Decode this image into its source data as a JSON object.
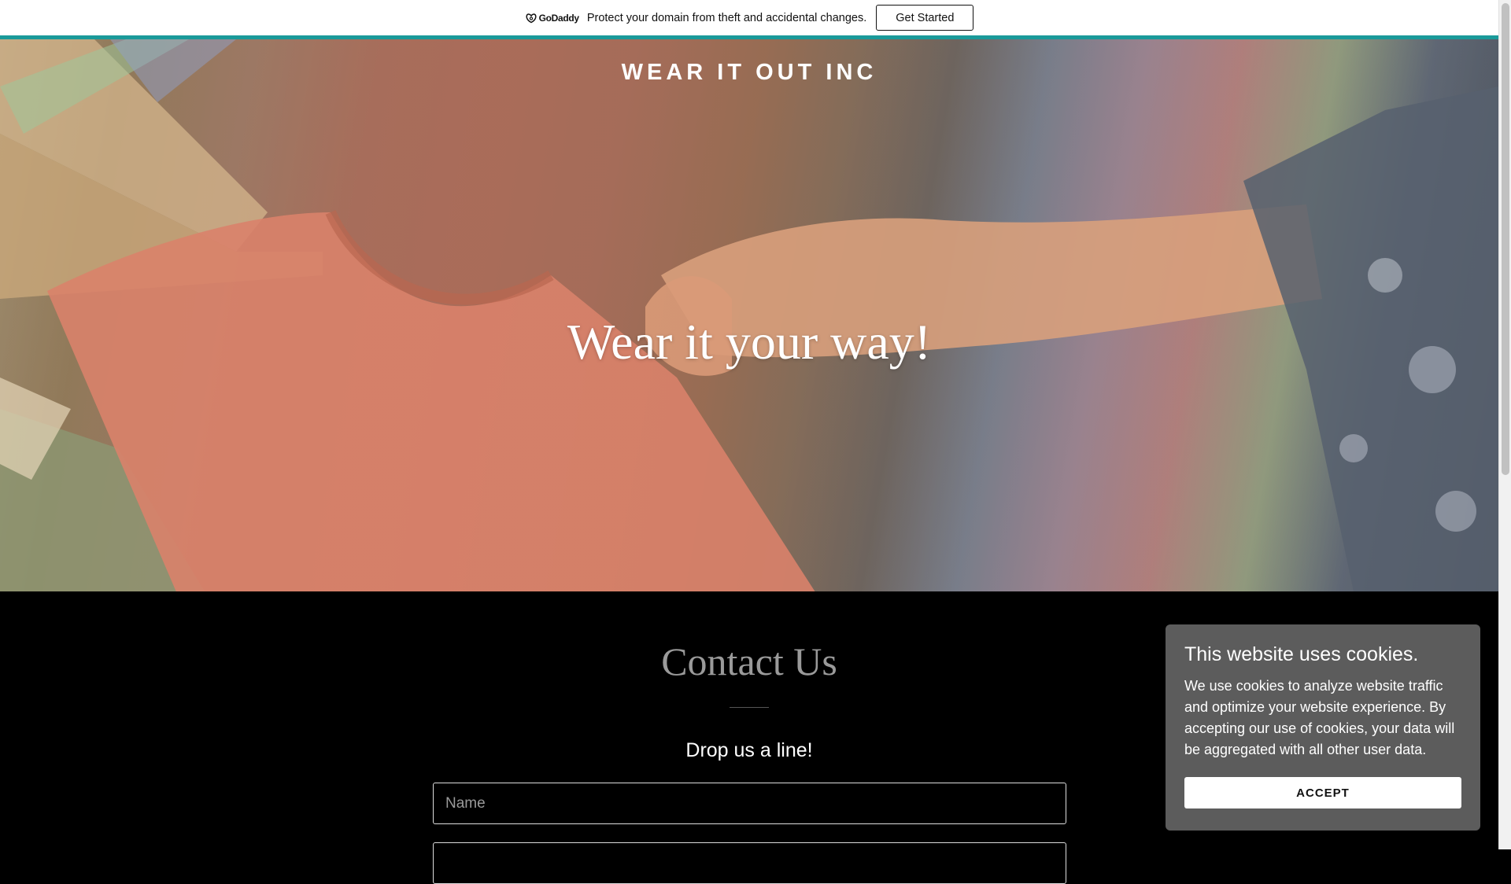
{
  "promo_bar": {
    "logo_text": "GoDaddy",
    "message": "Protect your domain from theft and accidental changes.",
    "button_label": "Get Started"
  },
  "hero": {
    "site_title": "WEAR IT OUT INC",
    "tagline": "Wear it your way!"
  },
  "contact": {
    "heading": "Contact Us",
    "subheading": "Drop us a line!",
    "name_placeholder": "Name"
  },
  "cookie_banner": {
    "title": "This website uses cookies.",
    "body": "We use cookies to analyze website traffic and optimize your website experience. By accepting our use of cookies, your data will be aggregated with all other user data.",
    "accept_label": "ACCEPT"
  },
  "colors": {
    "accent": "#1a9a9a",
    "cookie_background": "#5c5c5c",
    "page_background": "#000000"
  }
}
